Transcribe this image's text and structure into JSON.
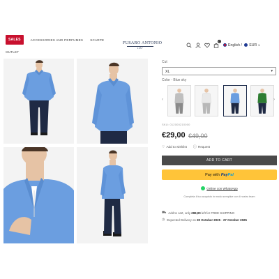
{
  "header": {
    "nav": {
      "sales": "SALES",
      "accessories": "ACCESSORIES AND PERFUMES",
      "shoes": "SCARPE",
      "outlet": "OUTLET"
    },
    "logo": {
      "name": "FUSARO ANTONIO",
      "sub": "1957"
    },
    "icons": [
      "search-icon",
      "user-icon",
      "heart-icon",
      "cart-icon"
    ],
    "cart_count": "0",
    "language": "English",
    "currency": "EUR"
  },
  "gallery": {
    "images": [
      "model-front",
      "model-three-quarter",
      "model-collar-closeup",
      "model-side"
    ]
  },
  "product": {
    "cut_label": "Cut",
    "cut_value": "XL",
    "color_label": "Color - Blue sky",
    "sku": "SKU: 012000210000",
    "price": "€29,00",
    "old_price": "€49,00",
    "wishlist": "Add to wishlist",
    "request": "Request",
    "add_to_cart": "ADD TO CART",
    "pay_with": "Pay with",
    "paypal_a": "Pay",
    "paypal_b": "Pal",
    "whatsapp": "Online con WhatsApp",
    "whatsapp_note": "Completa il tuo acquisto in modo semplice con il nostro team",
    "shipping_pre": "Add to cart, only",
    "shipping_amount": "€99,00",
    "shipping_post": "left for FREE SHIPPING",
    "delivery_pre": "Expected Delivery on",
    "delivery_from": "20 October 2025",
    "delivery_mid": "-",
    "delivery_to": "27 October 2025"
  },
  "colors": {
    "accent_sales": "#c8102e",
    "cart_button": "#4a4a4a",
    "paypal_button": "#ffc439",
    "sweater": "#6b9ee0",
    "trousers": "#1f2a44"
  }
}
